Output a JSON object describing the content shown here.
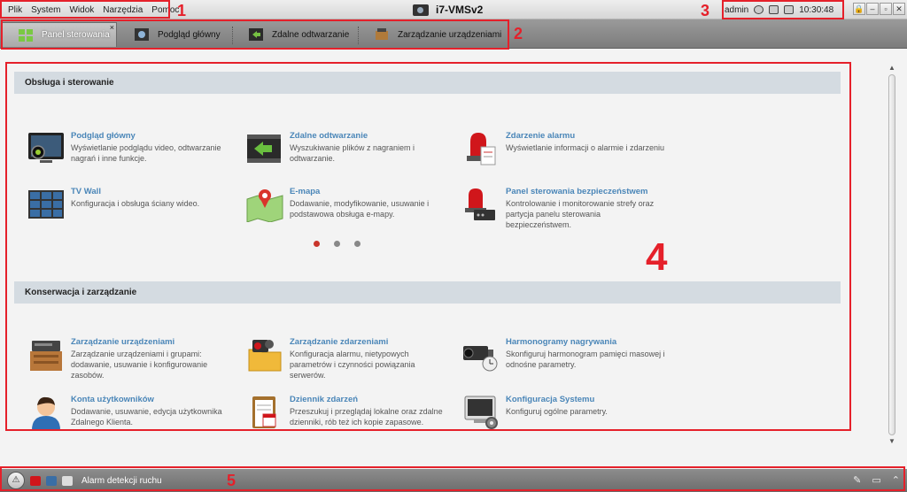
{
  "menu": {
    "items": [
      "Plik",
      "System",
      "Widok",
      "Narzędzia",
      "Pomoc"
    ]
  },
  "app": {
    "title": "i7-VMSv2"
  },
  "status": {
    "user": "admin",
    "time": "10:30:48"
  },
  "window_buttons": [
    "🔒",
    "–",
    "▫",
    "✕"
  ],
  "tabs": [
    {
      "label": "Panel sterowania",
      "active": true,
      "close": "×"
    },
    {
      "label": "Podgląd główny"
    },
    {
      "label": "Zdalne odtwarzanie"
    },
    {
      "label": "Zarządzanie urządzeniami"
    }
  ],
  "sections": [
    {
      "title": "Obsługa i sterowanie",
      "items": [
        {
          "title": "Podgląd główny",
          "desc": "Wyświetlanie podglądu video, odtwarzanie nagrań i inne funkcje.",
          "icon": "monitor-icon"
        },
        {
          "title": "Zdalne odtwarzanie",
          "desc": "Wyszukiwanie plików z nagraniem i odtwarzanie.",
          "icon": "playback-icon"
        },
        {
          "title": "Zdarzenie alarmu",
          "desc": "Wyświetlanie informacji o alarmie i zdarzeniu",
          "icon": "alarm-light-icon"
        },
        {
          "title": "TV Wall",
          "desc": "Konfiguracja i obsługa ściany wideo.",
          "icon": "tv-wall-icon"
        },
        {
          "title": "E-mapa",
          "desc": "Dodawanie, modyfikowanie, usuwanie i podstawowa obsługa e-mapy.",
          "icon": "map-icon"
        },
        {
          "title": "Panel sterowania bezpieczeństwem",
          "desc": "Kontrolowanie i monitorowanie strefy oraz partycja panelu sterowania bezpieczeństwem.",
          "icon": "security-panel-icon"
        }
      ]
    },
    {
      "title": "Konserwacja i zarządzanie",
      "items": [
        {
          "title": "Zarządzanie urządzeniami",
          "desc": "Zarządzanie urządzeniami i grupami: dodawanie, usuwanie i konfigurowanie zasobów.",
          "icon": "device-icon"
        },
        {
          "title": "Zarządzanie zdarzeniami",
          "desc": "Konfiguracja alarmu, nietypowych parametrów i czynności powiązania serwerów.",
          "icon": "event-folder-icon"
        },
        {
          "title": "Harmonogramy nagrywania",
          "desc": "Skonfiguruj harmonogram pamięci masowej i odnośne parametry.",
          "icon": "camera-schedule-icon"
        },
        {
          "title": "Konta użytkowników",
          "desc": "Dodawanie, usuwanie, edycja użytkownika Zdalnego Klienta.",
          "icon": "user-icon"
        },
        {
          "title": "Dziennik zdarzeń",
          "desc": "Przeszukuj i przeglądaj lokalne oraz zdalne dzienniki, rób też ich kopie zapasowe.",
          "icon": "calendar-log-icon"
        },
        {
          "title": "Konfiguracja Systemu",
          "desc": "Konfiguruj ogólne parametry.",
          "icon": "system-config-icon"
        }
      ]
    }
  ],
  "pager": {
    "pages": 3,
    "current": 1
  },
  "bottom": {
    "alarm_text": "Alarm detekcji ruchu"
  },
  "annotations": [
    "1",
    "2",
    "3",
    "4",
    "5"
  ],
  "colors": {
    "accent": "#4a86b8",
    "annotation": "#e5202a",
    "section": "#d4dbe1"
  }
}
